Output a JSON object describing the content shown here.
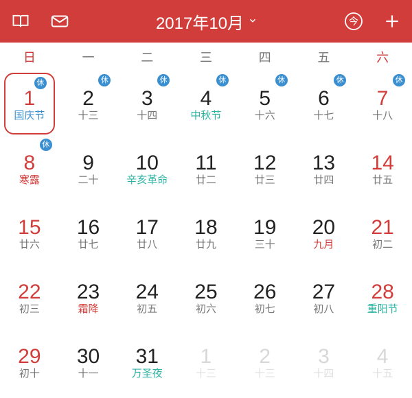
{
  "header": {
    "title": "2017年10月",
    "today_label": "今"
  },
  "weekdays": [
    "日",
    "一",
    "二",
    "三",
    "四",
    "五",
    "六"
  ],
  "badge_char": "休",
  "days": [
    {
      "n": "1",
      "sub": "国庆节",
      "red": true,
      "subColor": "blue",
      "badge": true,
      "sel": true
    },
    {
      "n": "2",
      "sub": "十三",
      "badge": true
    },
    {
      "n": "3",
      "sub": "十四",
      "badge": true
    },
    {
      "n": "4",
      "sub": "中秋节",
      "subColor": "teal",
      "badge": true
    },
    {
      "n": "5",
      "sub": "十六",
      "badge": true
    },
    {
      "n": "6",
      "sub": "十七",
      "badge": true
    },
    {
      "n": "7",
      "sub": "十八",
      "red": true,
      "badge": true
    },
    {
      "n": "8",
      "sub": "寒露",
      "red": true,
      "subColor": "red",
      "badge": true
    },
    {
      "n": "9",
      "sub": "二十"
    },
    {
      "n": "10",
      "sub": "辛亥革命",
      "subColor": "teal"
    },
    {
      "n": "11",
      "sub": "廿二"
    },
    {
      "n": "12",
      "sub": "廿三"
    },
    {
      "n": "13",
      "sub": "廿四"
    },
    {
      "n": "14",
      "sub": "廿五",
      "red": true
    },
    {
      "n": "15",
      "sub": "廿六",
      "red": true
    },
    {
      "n": "16",
      "sub": "廿七"
    },
    {
      "n": "17",
      "sub": "廿八"
    },
    {
      "n": "18",
      "sub": "廿九"
    },
    {
      "n": "19",
      "sub": "三十"
    },
    {
      "n": "20",
      "sub": "九月",
      "subColor": "red"
    },
    {
      "n": "21",
      "sub": "初二",
      "red": true
    },
    {
      "n": "22",
      "sub": "初三",
      "red": true
    },
    {
      "n": "23",
      "sub": "霜降",
      "subColor": "red"
    },
    {
      "n": "24",
      "sub": "初五"
    },
    {
      "n": "25",
      "sub": "初六"
    },
    {
      "n": "26",
      "sub": "初七"
    },
    {
      "n": "27",
      "sub": "初八"
    },
    {
      "n": "28",
      "sub": "重阳节",
      "red": true,
      "subColor": "teal"
    },
    {
      "n": "29",
      "sub": "初十",
      "red": true
    },
    {
      "n": "30",
      "sub": "十一"
    },
    {
      "n": "31",
      "sub": "万圣夜",
      "subColor": "teal"
    },
    {
      "n": "1",
      "sub": "十三",
      "faded": true
    },
    {
      "n": "2",
      "sub": "十三",
      "faded": true
    },
    {
      "n": "3",
      "sub": "十四",
      "faded": true
    },
    {
      "n": "4",
      "sub": "十五",
      "faded": true
    }
  ]
}
